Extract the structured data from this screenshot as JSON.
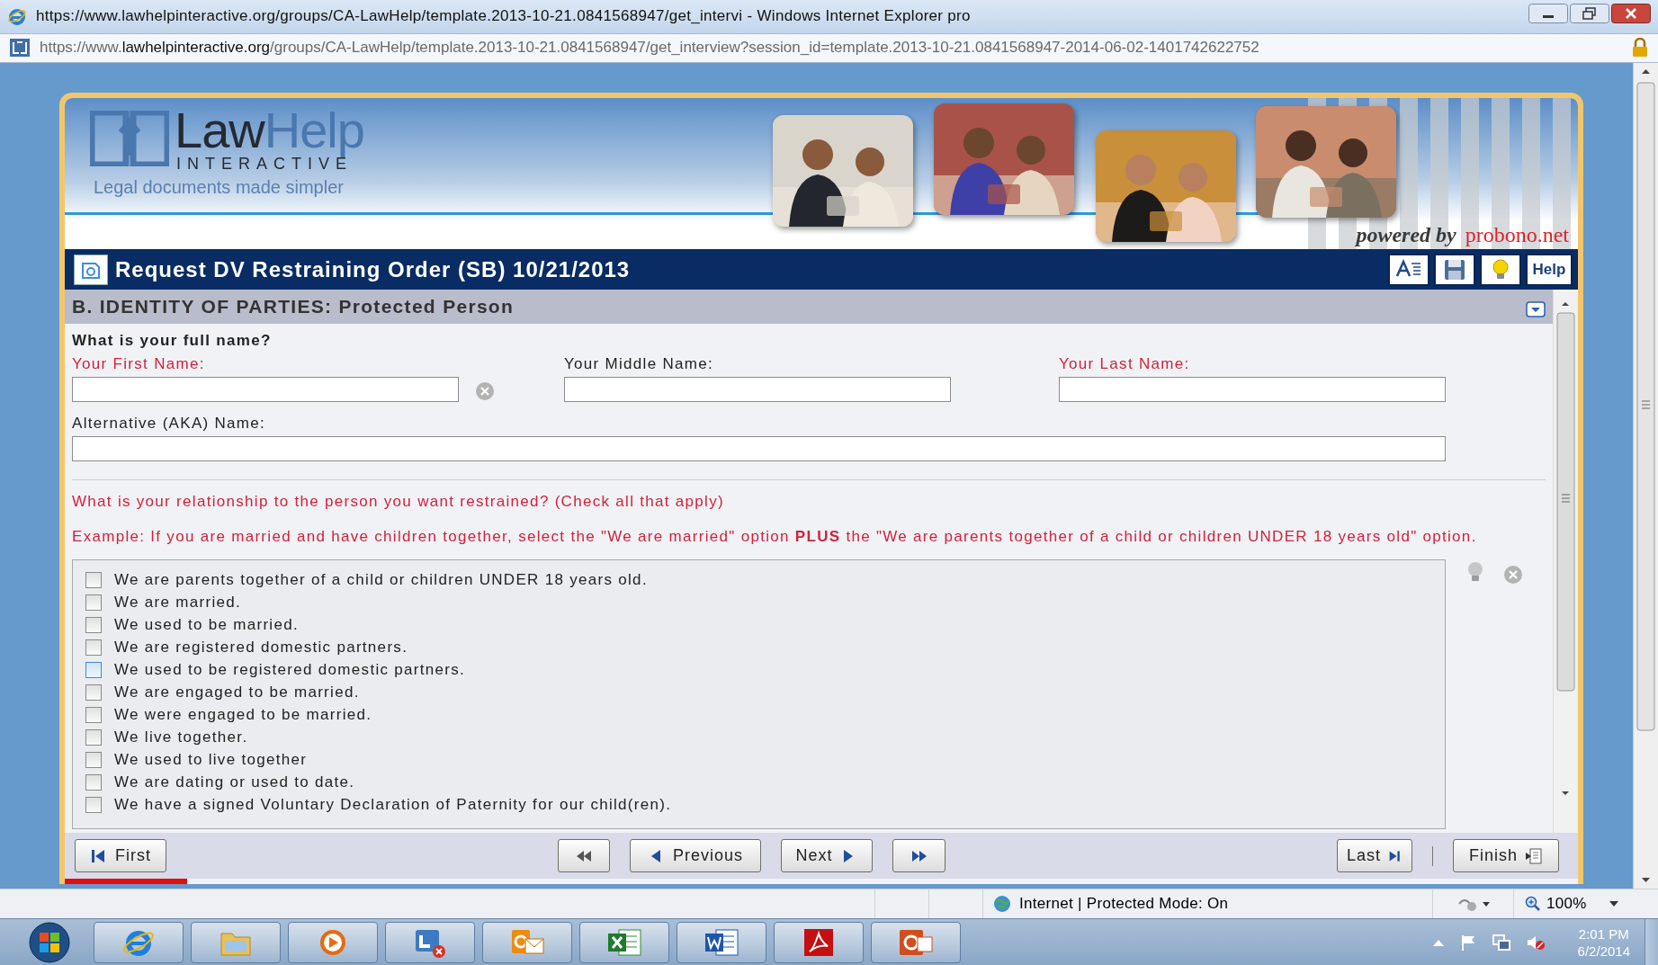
{
  "browser": {
    "title": "https://www.lawhelpinteractive.org/groups/CA-LawHelp/template.2013-10-21.0841568947/get_intervi - Windows Internet Explorer pro",
    "address": "https://www.**lawhelpinteractive.org**/groups/CA-LawHelp/template.2013-10-21.0841568947/get_interview?session_id=template.2013-10-21.0841568947-2014-06-02-1401742622752"
  },
  "header": {
    "logo_name": "Law**Help**",
    "logo_sub": "INTERACTIVE",
    "tagline": "Legal documents made simpler",
    "powered_by": "powered by",
    "partner": "probono.net"
  },
  "toolbar": {
    "title": "Request DV Restraining Order (SB) 10/21/2013",
    "buttons": [
      {
        "kind": "text-size"
      },
      {
        "kind": "save"
      },
      {
        "kind": "hint"
      },
      {
        "kind": "help",
        "label": "Help"
      }
    ]
  },
  "section": {
    "title": "B. IDENTITY OF PARTIES: Protected Person"
  },
  "name_question": "What is your full name?",
  "name_fields": [
    {
      "label": "Your First Name:",
      "required": true,
      "clearable": true
    },
    {
      "label": "Your Middle Name:",
      "required": false
    },
    {
      "label": "Your Last Name:",
      "required": true
    }
  ],
  "aka_field": {
    "label": "Alternative (AKA) Name:",
    "required": false
  },
  "relationship": {
    "question": "What is your relationship to the person you want restrained? (Check all that apply)",
    "example": "Example: If you are married and have children together, select the \"We are married\" option **PLUS** the \"We are parents together of a child or children UNDER 18 years old\" option.",
    "options": [
      {
        "label": "We are parents together of a child or children UNDER 18 years old.",
        "checked": false,
        "focused": false
      },
      {
        "label": "We are married.",
        "checked": false,
        "focused": false
      },
      {
        "label": "We used to be married.",
        "checked": false,
        "focused": false
      },
      {
        "label": "We are registered domestic partners.",
        "checked": false,
        "focused": false
      },
      {
        "label": "We used to be registered domestic partners.",
        "checked": false,
        "focused": true
      },
      {
        "label": "We are engaged to be married.",
        "checked": false,
        "focused": false
      },
      {
        "label": "We were engaged to be married.",
        "checked": false,
        "focused": false
      },
      {
        "label": "We live together.",
        "checked": false,
        "focused": false
      },
      {
        "label": "We used to live together",
        "checked": false,
        "focused": false
      },
      {
        "label": "We are dating or used to date.",
        "checked": false,
        "focused": false
      },
      {
        "label": "We have a signed Voluntary Declaration of Paternity for our child(ren).",
        "checked": false,
        "focused": false
      }
    ]
  },
  "nav": [
    {
      "kind": "first",
      "label": "First"
    },
    {
      "kind": "rewind"
    },
    {
      "kind": "previous",
      "label": "Previous"
    },
    {
      "kind": "next",
      "label": "Next"
    },
    {
      "kind": "forward"
    },
    {
      "kind": "last",
      "label": "Last"
    },
    {
      "kind": "finish",
      "label": "Finish"
    }
  ],
  "status_bar": {
    "zone": "Internet | Protected Mode: On",
    "zoom": "100%"
  },
  "taskbar": {
    "apps": [
      {
        "kind": "browser"
      },
      {
        "kind": "folder"
      },
      {
        "kind": "media"
      },
      {
        "kind": "chat"
      },
      {
        "kind": "mail"
      },
      {
        "kind": "sheet"
      },
      {
        "kind": "doc"
      },
      {
        "kind": "pdf"
      },
      {
        "kind": "slides"
      }
    ],
    "time": "2:01 PM",
    "date": "6/2/2014"
  }
}
